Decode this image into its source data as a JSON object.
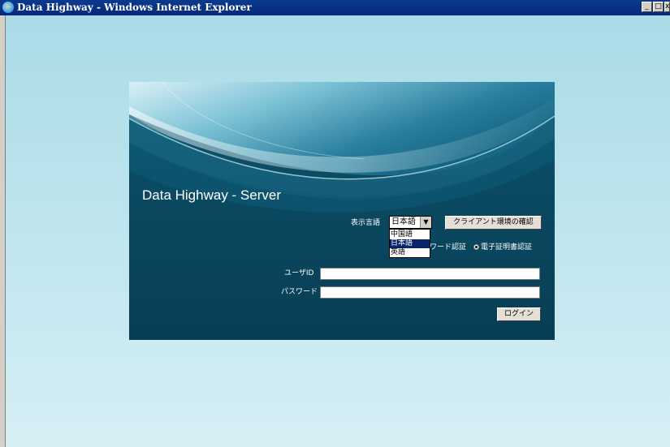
{
  "window": {
    "title": "Data Highway - Windows Internet Explorer",
    "minimize": "_",
    "maximize": "□",
    "close": "x"
  },
  "login": {
    "server_title": "Data Highway - Server",
    "language_label": "表示言語",
    "language_selected": "日本語",
    "language_options": [
      "中国語",
      "日本語",
      "英語"
    ],
    "language_highlighted": "日本語",
    "client_check_button": "クライアント環境の確認",
    "auth_password_label": "ワード認証",
    "auth_certificate_label": "電子証明書認証",
    "auth_selected": "certificate",
    "user_id_label": "ユーザID",
    "user_id_value": "",
    "password_label": "パスワード",
    "password_value": "",
    "login_button": "ログイン"
  },
  "colors": {
    "panel": "#0a475f",
    "background": "#bfe5ee",
    "titlebar": "#0a3a8c",
    "selection": "#0a246a"
  }
}
